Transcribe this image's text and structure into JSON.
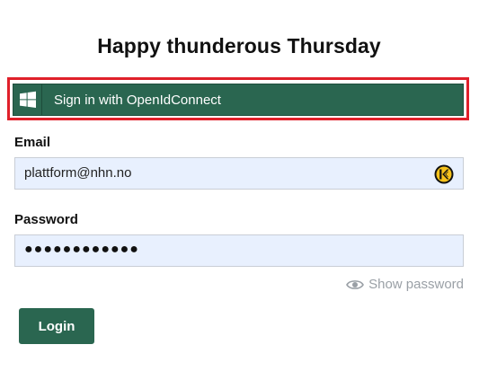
{
  "page": {
    "title": "Happy thunderous Thursday"
  },
  "oidc": {
    "label": "Sign in with OpenIdConnect",
    "icon": "windows-icon"
  },
  "email": {
    "label": "Email",
    "value": "plattform@nhn.no",
    "autofill_icon": "keeper-icon"
  },
  "password": {
    "label": "Password",
    "masked_value": "●●●●●●●●●●●●",
    "show_label": "Show password",
    "show_icon": "eye-icon"
  },
  "login": {
    "label": "Login"
  },
  "colors": {
    "brand_green": "#2a6650",
    "highlight_red": "#e0202a",
    "field_bg": "#e8f0fe",
    "muted_text": "#9aa0a6"
  }
}
